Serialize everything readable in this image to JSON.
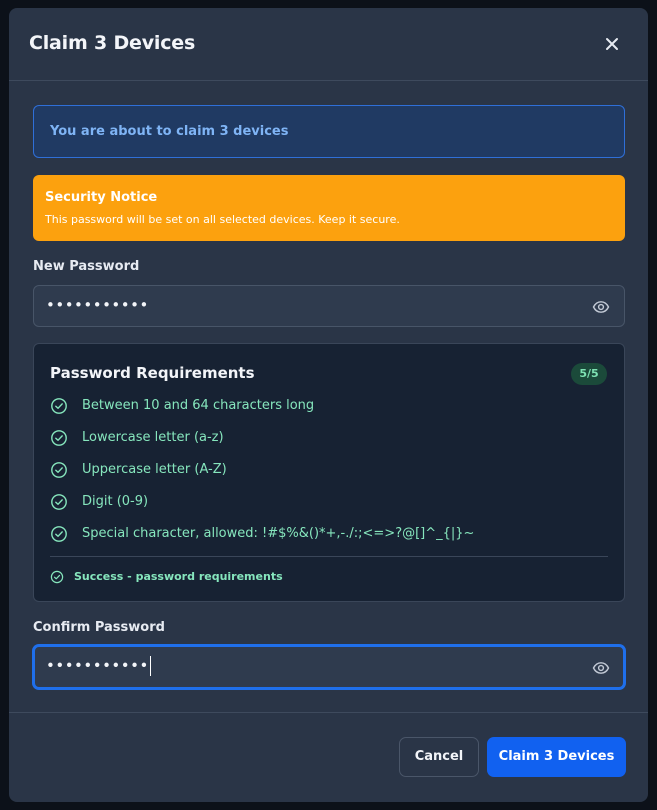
{
  "dialog": {
    "title": "Claim 3 Devices",
    "close_icon": "close-icon"
  },
  "info_banner": {
    "text": "You are about to claim 3 devices"
  },
  "security_notice": {
    "title": "Security Notice",
    "text": "This password will be set on all selected devices. Keep it secure."
  },
  "new_password": {
    "label": "New Password",
    "value": "•••••••••••",
    "toggle_icon": "eye-icon"
  },
  "requirements": {
    "title": "Password Requirements",
    "badge": "5/5",
    "items": [
      {
        "label": "Between 10 and 64 characters long",
        "met": true
      },
      {
        "label": "Lowercase letter (a-z)",
        "met": true
      },
      {
        "label": "Uppercase letter (A-Z)",
        "met": true
      },
      {
        "label": "Digit (0-9)",
        "met": true
      },
      {
        "label": "Special character, allowed: !#$%&()*+,-./:;<=>?@[]^_{|}~",
        "met": true
      }
    ],
    "status": "Success - password requirements"
  },
  "confirm_password": {
    "label": "Confirm Password",
    "value": "•••••••••••",
    "toggle_icon": "eye-icon"
  },
  "footer": {
    "cancel_label": "Cancel",
    "confirm_label": "Claim 3 Devices"
  },
  "colors": {
    "modal_bg": "#2a3547",
    "info_bg": "#203a63",
    "info_text": "#7fb4f5",
    "notice_bg": "#fca10e",
    "success": "#86e6bd",
    "primary": "#1161f0"
  }
}
